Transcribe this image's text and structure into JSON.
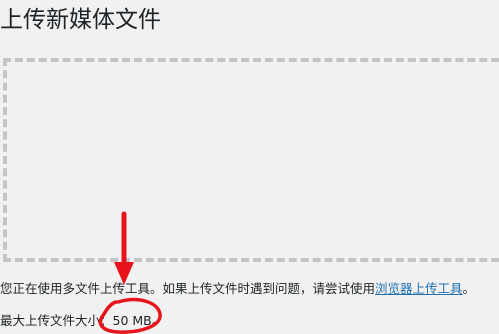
{
  "page": {
    "title": "上传新媒体文件"
  },
  "uploader": {
    "info_prefix": "您正在使用多文件上传工具。如果上传文件时遇到问题，请尝试使用",
    "browser_uploader_link": "浏览器上传工具",
    "info_suffix": "。",
    "max_size_label": "最大上传文件大小：",
    "max_size_value": "50 MB",
    "max_size_suffix": "。"
  },
  "annotation": {
    "color": "#e8141b",
    "arrow": "red-down-arrow",
    "highlight": "red-circle-around-max-size"
  }
}
